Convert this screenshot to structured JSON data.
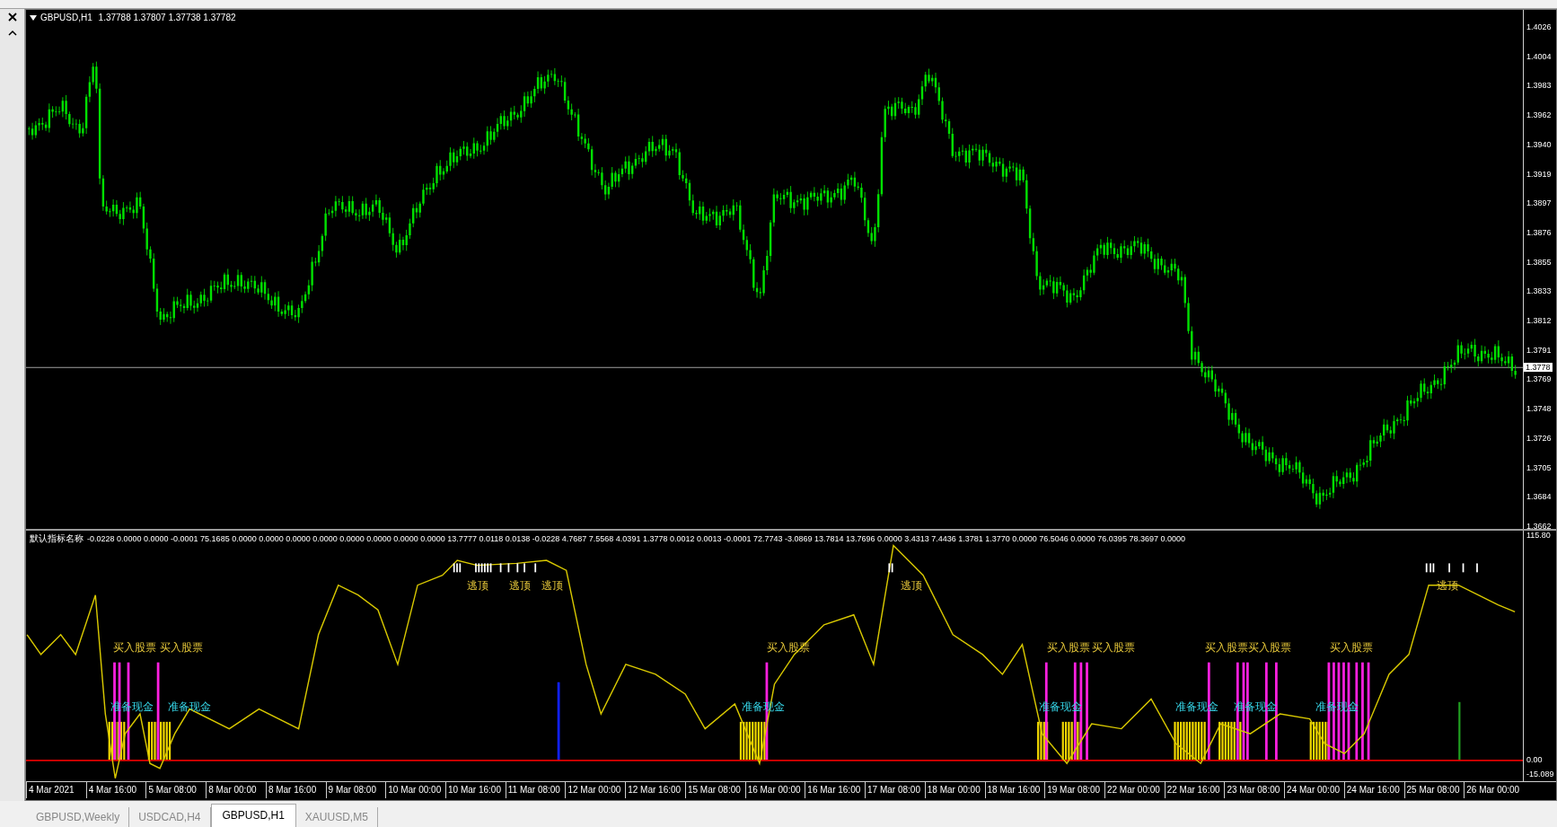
{
  "chart": {
    "symbol": "GBPUSD,H1",
    "ohlc": "1.37788 1.37807 1.37738 1.37782",
    "price_axis": [
      "1.4026",
      "1.4004",
      "1.3983",
      "1.3962",
      "1.3940",
      "1.3919",
      "1.3897",
      "1.3876",
      "1.3855",
      "1.3833",
      "1.3812",
      "1.3791",
      "1.3769",
      "1.3748",
      "1.3726",
      "1.3705",
      "1.3684",
      "1.3662"
    ],
    "current_price": "1.3778"
  },
  "indicator": {
    "name": "默认指标名称",
    "values": "-0.0228 0.0000 0.0000 -0.0001 75.1685 0.0000 0.0000 0.0000 0.0000 0.0000 0.0000 0.0000 0.0000 13.7777 0.0118 0.0138 -0.0228 4.7687 7.5568 4.0391 1.3778 0.0012 0.0013 -0.0001 72.7743 -3.0869 13.7814 13.7696 0.0000 3.4313 7.4436 1.3781 1.3770 0.0000 76.5046 0.0000 76.0395 78.3697 0.0000",
    "axis": [
      "115.80",
      "0.00",
      "-15.089"
    ],
    "signals": [
      {
        "text": "逃顶",
        "kind": "top"
      },
      {
        "text": "逃顶",
        "kind": "top"
      },
      {
        "text": "逃顶",
        "kind": "top"
      },
      {
        "text": "逃顶",
        "kind": "top"
      },
      {
        "text": "逃顶",
        "kind": "top"
      },
      {
        "text": "买入股票",
        "kind": "buy"
      },
      {
        "text": "买入股票",
        "kind": "buy"
      },
      {
        "text": "买入股票",
        "kind": "buy"
      },
      {
        "text": "买入股票",
        "kind": "buy"
      },
      {
        "text": "买入股票",
        "kind": "buy"
      },
      {
        "text": "买入股票",
        "kind": "buy"
      },
      {
        "text": "买入股票",
        "kind": "buy"
      },
      {
        "text": "买入股票",
        "kind": "buy"
      },
      {
        "text": "准备现金",
        "kind": "cash"
      },
      {
        "text": "准备现金",
        "kind": "cash"
      },
      {
        "text": "准备现金",
        "kind": "cash"
      },
      {
        "text": "准备现金",
        "kind": "cash"
      },
      {
        "text": "准备现金",
        "kind": "cash"
      },
      {
        "text": "准备现金",
        "kind": "cash"
      },
      {
        "text": "准备现金",
        "kind": "cash"
      }
    ]
  },
  "time_axis": [
    "4 Mar 2021",
    "4 Mar 16:00",
    "5 Mar 08:00",
    "8 Mar 00:00",
    "8 Mar 16:00",
    "9 Mar 08:00",
    "10 Mar 00:00",
    "10 Mar 16:00",
    "11 Mar 08:00",
    "12 Mar 00:00",
    "12 Mar 16:00",
    "15 Mar 08:00",
    "16 Mar 00:00",
    "16 Mar 16:00",
    "17 Mar 08:00",
    "18 Mar 00:00",
    "18 Mar 16:00",
    "19 Mar 08:00",
    "22 Mar 00:00",
    "22 Mar 16:00",
    "23 Mar 08:00",
    "24 Mar 00:00",
    "24 Mar 16:00",
    "25 Mar 08:00",
    "26 Mar 00:00"
  ],
  "tabs": [
    {
      "label": "GBPUSD,Weekly",
      "selected": false
    },
    {
      "label": "USDCAD,H4",
      "selected": false
    },
    {
      "label": "GBPUSD,H1",
      "selected": true
    },
    {
      "label": "XAUUSD,M5",
      "selected": false
    }
  ]
}
